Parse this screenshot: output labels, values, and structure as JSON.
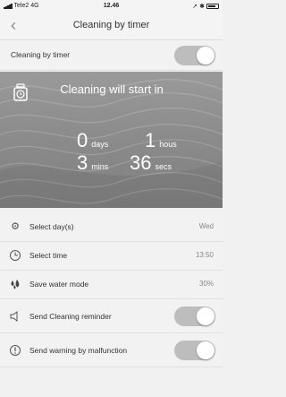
{
  "status_bar": {
    "carrier": "Tele2",
    "network": "4G",
    "time": "12.46"
  },
  "nav": {
    "back_icon": "chevron-left-icon",
    "title": "Cleaning by timer"
  },
  "main_toggle": {
    "label": "Cleaning by timer",
    "on": true
  },
  "countdown": {
    "title": "Cleaning will start in",
    "days": {
      "value": "0",
      "unit": "days"
    },
    "hours": {
      "value": "1",
      "unit": "hous"
    },
    "mins": {
      "value": "3",
      "unit": "mins"
    },
    "secs": {
      "value": "36",
      "unit": "secs"
    }
  },
  "settings": [
    {
      "icon": "gear-icon",
      "label": "Select day(s)",
      "value": "Wed"
    },
    {
      "icon": "clock-icon",
      "label": "Select time",
      "value": "13:50"
    },
    {
      "icon": "water-drops-icon",
      "label": "Save water mode",
      "value": "30%"
    },
    {
      "icon": "speaker-icon",
      "label": "Send Cleaning reminder",
      "toggle_on": true
    },
    {
      "icon": "warning-icon",
      "label": "Send warning by malfunction",
      "toggle_on": true
    }
  ],
  "colors": {
    "background": "#f1f1f1",
    "hero": "#8c8c8c",
    "toggle_track": "#bdbdbd"
  }
}
